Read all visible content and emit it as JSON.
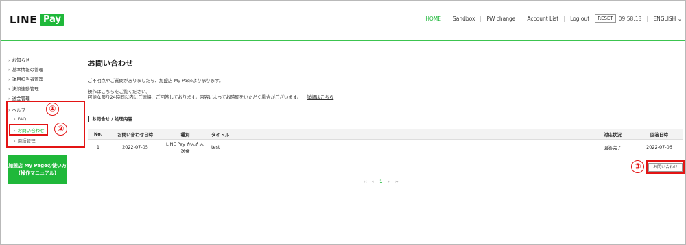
{
  "header": {
    "logo_line": "LINE",
    "logo_pay": "Pay",
    "nav": {
      "home": "HOME",
      "sandbox": "Sandbox",
      "pw_change": "PW change",
      "account_list": "Account List",
      "logout": "Log out",
      "reset": "RESET",
      "timer": "09:58:13",
      "language": "ENGLISH"
    }
  },
  "sidebar": {
    "items": [
      {
        "label": "お知らせ"
      },
      {
        "label": "基本情報の管理"
      },
      {
        "label": "運用担当者管理"
      },
      {
        "label": "決済連動管理"
      },
      {
        "label": "送金管理"
      }
    ],
    "help": "ヘルプ",
    "help_items": [
      {
        "label": "FAQ"
      },
      {
        "label": "お問い合わせ"
      },
      {
        "label": "用語管理"
      }
    ],
    "manual_button": "加盟店 My Pageの使い方\n(操作マニュアル)"
  },
  "annotations": [
    "①",
    "②",
    "③"
  ],
  "main": {
    "title": "お問い合わせ",
    "intro": "ご不明点やご質問がありましたら、加盟店 My Pageより承ります。",
    "note1": "操作はこちらをご覧ください。",
    "note2": "可能な限り24時間以内にご連絡、ご回答しております。内容によってお時間をいただく場合がございます。",
    "details_link": "詳細はこちら",
    "section_title": "お問合せ / 処理内容",
    "table": {
      "headers": [
        "No.",
        "お問い合わせ日時",
        "種別",
        "タイトル",
        "対応状況",
        "回答日時"
      ],
      "rows": [
        {
          "no": "1",
          "date": "2022-07-05",
          "type": "LINE Pay かんたん送金",
          "title": "test",
          "status": "回答完了",
          "answer_date": "2022-07-06"
        }
      ]
    },
    "inquiry_button": "お問い合わせ",
    "pagination": {
      "first": "‹‹",
      "prev": "‹",
      "current": "1",
      "next": "›",
      "last": "››"
    }
  },
  "colors": {
    "accent": "#1fb83a",
    "annotation": "#e31414"
  }
}
